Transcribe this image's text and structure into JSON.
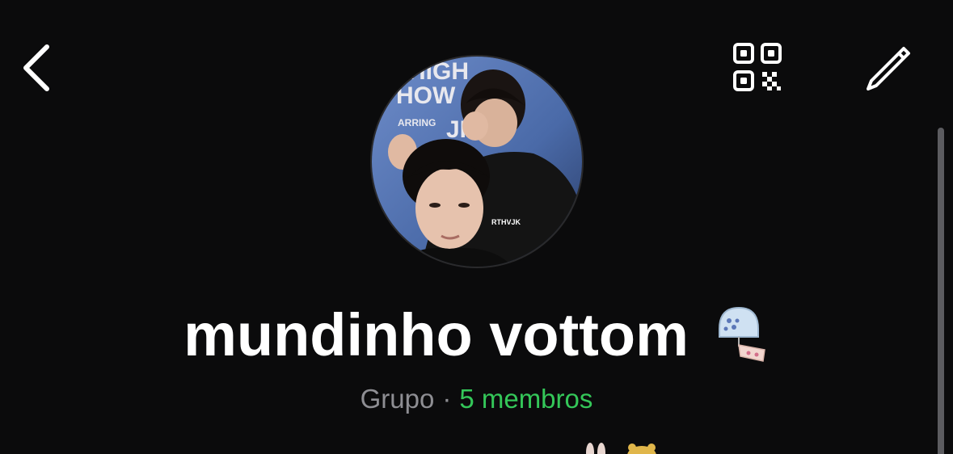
{
  "header": {
    "back_icon": "chevron-left-icon",
    "qr_icon": "qr-code-icon",
    "edit_icon": "pencil-icon"
  },
  "group": {
    "name": "mundinho vottom",
    "avatar_watermark": "RTHVJK",
    "type_label": "Grupo",
    "separator": "·",
    "members_label": "5 membros",
    "title_emoji_icon": "wind-chime-emoji-icon"
  },
  "colors": {
    "background": "#0b0b0c",
    "members_accent": "#34c759",
    "secondary_text": "#8e8e93"
  }
}
